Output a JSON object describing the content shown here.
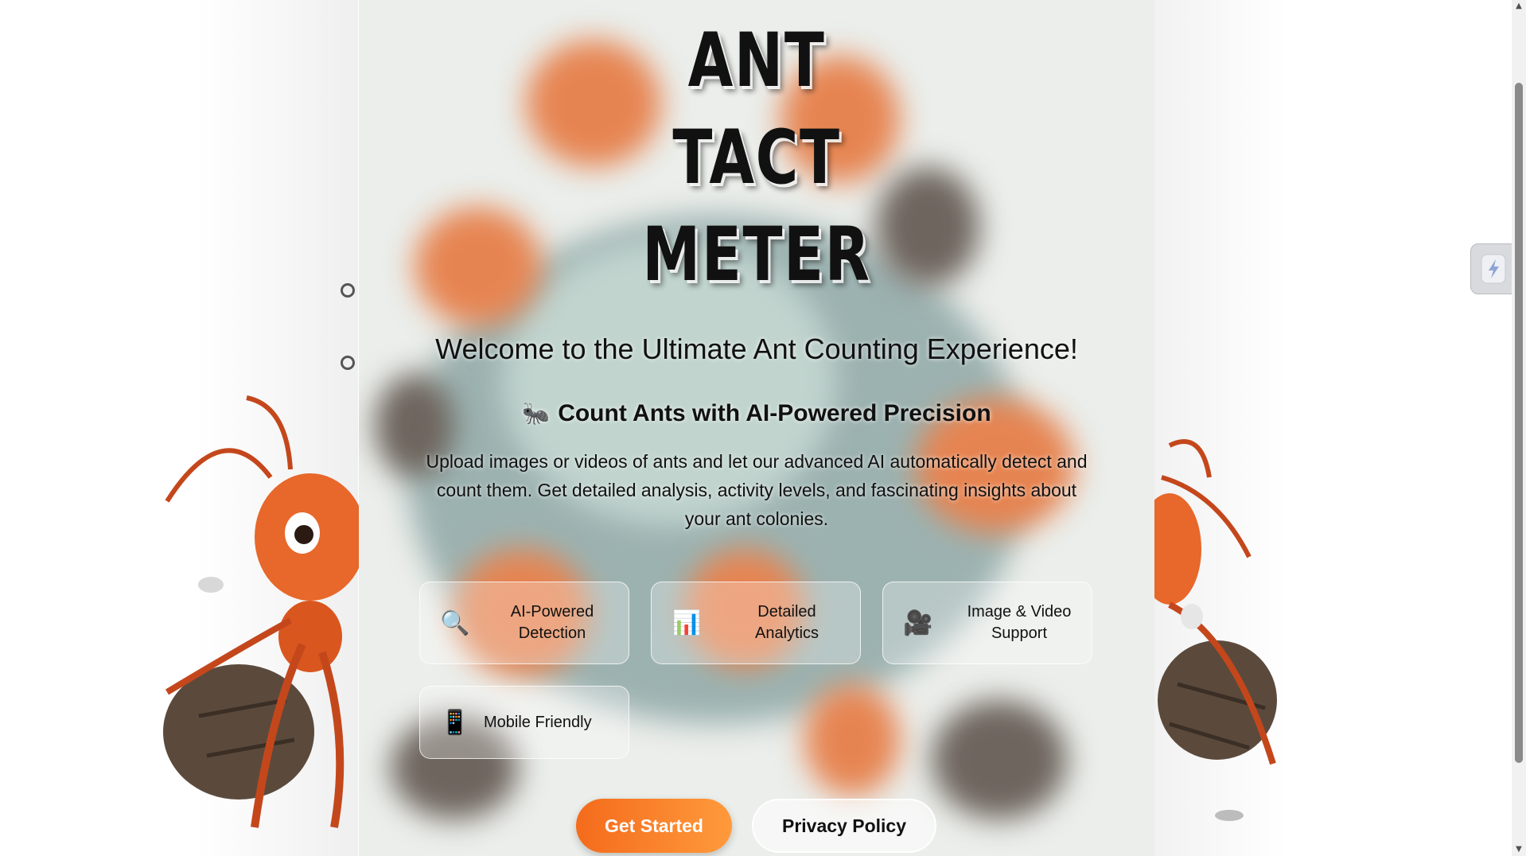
{
  "hero": {
    "title_lines": [
      "ANT",
      "TACT",
      "METER"
    ],
    "welcome": "Welcome to the Ultimate Ant Counting Experience!",
    "subheading": "Count Ants with AI-Powered Precision",
    "subheading_icon": "🐜",
    "description": "Upload images or videos of ants and let our advanced AI automatically detect and count them. Get detailed analysis, activity levels, and fascinating insights about your ant colonies."
  },
  "features": [
    {
      "icon": "🔍",
      "icon_name": "magnifier-icon",
      "label": "AI-Powered Detection"
    },
    {
      "icon": "📊",
      "icon_name": "bar-chart-icon",
      "label": "Detailed Analytics"
    },
    {
      "icon": "🎥",
      "icon_name": "video-camera-icon",
      "label": "Image & Video Support"
    },
    {
      "icon": "📱",
      "icon_name": "mobile-phone-icon",
      "label": "Mobile Friendly"
    }
  ],
  "buttons": {
    "get_started": "Get Started",
    "privacy_policy": "Privacy Policy"
  },
  "colors": {
    "primary_button_start": "#f46b1c",
    "primary_button_end": "#ff9a3c",
    "text": "#111111"
  }
}
